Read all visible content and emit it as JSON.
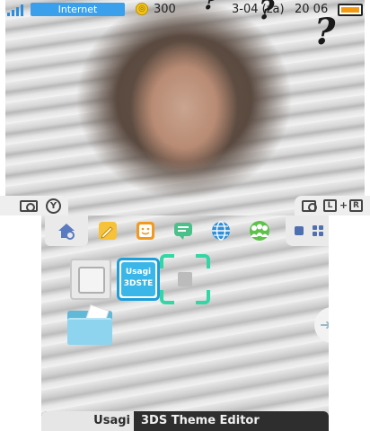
{
  "status": {
    "network_label": "Internet",
    "coins": "300",
    "date": "3-04 (za)",
    "time": "20 06",
    "signal_bars": 4,
    "battery_level": 0.75
  },
  "top_tabs": {
    "left_button": "Y",
    "right_buttons": [
      "L",
      "+",
      "R"
    ]
  },
  "home_menu": {
    "toolbar_icons": [
      "home-settings-icon",
      "pencil-icon",
      "smiley-icon",
      "chat-icon",
      "globe-icon",
      "friends-icon"
    ],
    "apps": [
      {
        "type": "empty"
      },
      {
        "type": "app",
        "label_line1": "Usagi",
        "label_line2": "3DSTE"
      },
      {
        "type": "cursor"
      },
      {
        "type": "folder"
      }
    ]
  },
  "title_bar": {
    "author": "Usagi",
    "title": "3DS Theme Editor"
  },
  "colors": {
    "accent": "#3aa0ec",
    "cursor": "#34d6a6",
    "coin": "#f2c41a",
    "battery": "#f39a12"
  }
}
